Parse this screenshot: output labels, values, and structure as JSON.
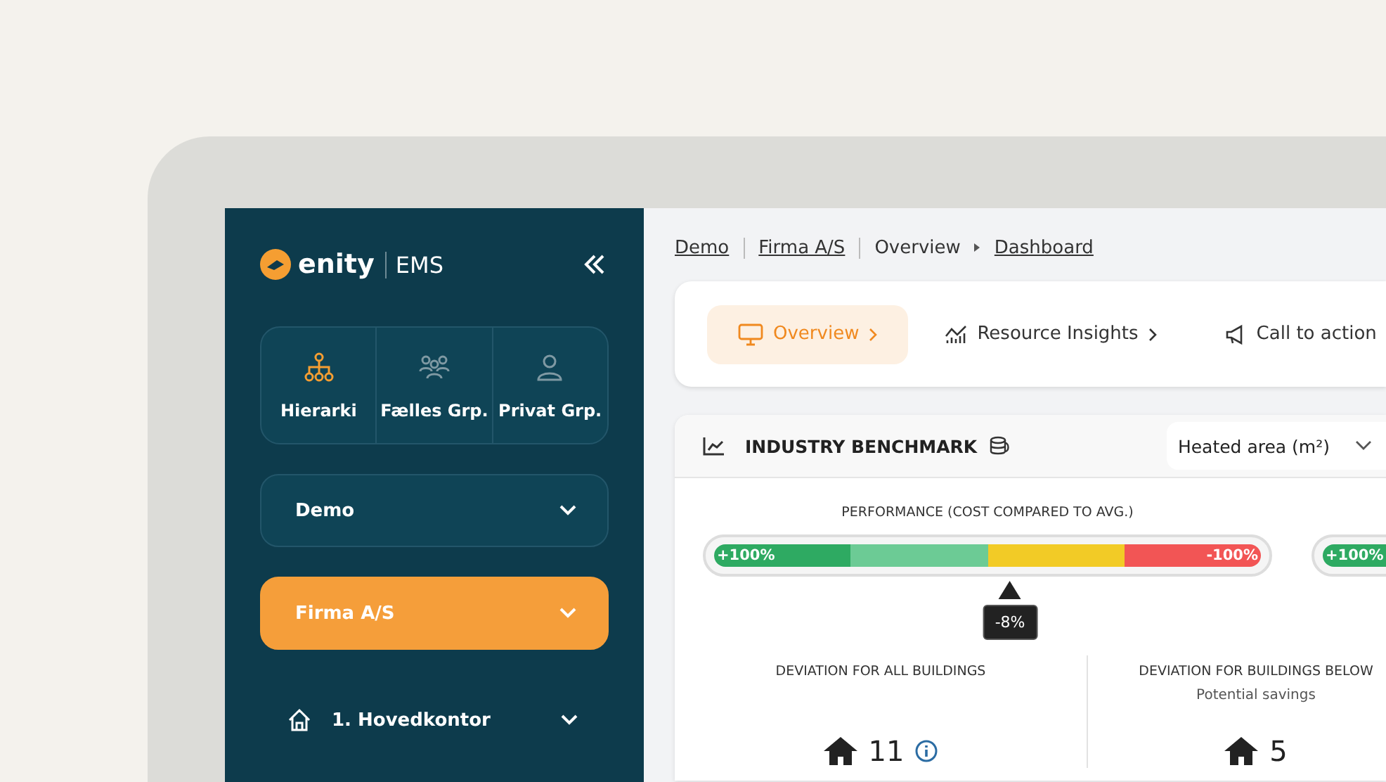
{
  "logo": {
    "brand": "enity",
    "product": "EMS"
  },
  "sidebar": {
    "group_tabs": [
      {
        "label": "Hierarki",
        "selected": true
      },
      {
        "label": "Fælles Grp.",
        "selected": false
      },
      {
        "label": "Privat Grp.",
        "selected": false
      }
    ],
    "selectors": [
      {
        "label": "Demo",
        "selected": false
      },
      {
        "label": "Firma A/S",
        "selected": true
      }
    ],
    "tree": [
      {
        "label": "1. Hovedkontor",
        "expanded": false
      }
    ]
  },
  "breadcrumb": [
    {
      "label": "Demo",
      "kind": "link"
    },
    {
      "label": "Firma A/S",
      "kind": "link"
    },
    {
      "label": "Overview",
      "kind": "plain"
    },
    {
      "label": "Dashboard",
      "kind": "link"
    }
  ],
  "nav_tabs": [
    {
      "label": "Overview",
      "kind": "monitor",
      "selected": true,
      "chevron": true
    },
    {
      "label": "Resource Insights",
      "kind": "chart",
      "selected": false,
      "chevron": true
    },
    {
      "label": "Call to action",
      "kind": "megaphone",
      "selected": false,
      "chevron": false
    }
  ],
  "benchmark": {
    "title": "INDUSTRY BENCHMARK",
    "dropdown": {
      "value": "Heated area (m²)"
    },
    "gauge_title": "PERFORMANCE (COST COMPARED TO AVG.)",
    "gauges": [
      {
        "left_label": "+100%",
        "right_label": "-100%",
        "marker": "-8%",
        "level": 0.54
      },
      {
        "left_label": "+100%"
      }
    ],
    "deviations": [
      {
        "title": "DEVIATION FOR ALL BUILDINGS",
        "count": "11",
        "info": true
      },
      {
        "title": "DEVIATION FOR BUILDINGS BELOW",
        "subtitle": "Potential savings",
        "count": "5",
        "info": false
      }
    ]
  }
}
